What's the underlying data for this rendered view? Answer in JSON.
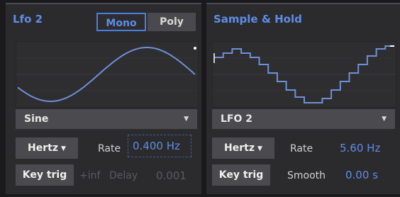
{
  "lfo": {
    "title": "Lfo 2",
    "mode_mono": "Mono",
    "mode_poly": "Poly",
    "waveform": "Sine",
    "unit_button": "Hertz",
    "rate_label": "Rate",
    "rate_value": "0.400 Hz",
    "keytrig_button": "Key trig",
    "delay_inf": "+inf",
    "delay_label": "Delay",
    "delay_value": "0.001"
  },
  "sh": {
    "title": "Sample & Hold",
    "source": "LFO 2",
    "unit_button": "Hertz",
    "rate_label": "Rate",
    "rate_value": "5.60 Hz",
    "keytrig_button": "Key trig",
    "smooth_label": "Smooth",
    "smooth_value": "0.00 s"
  },
  "colors": {
    "accent": "#5e8de6",
    "panel": "#2b2b2e",
    "button": "#4b4b4f"
  },
  "icons": {
    "dropdown": "caret-down-icon"
  }
}
